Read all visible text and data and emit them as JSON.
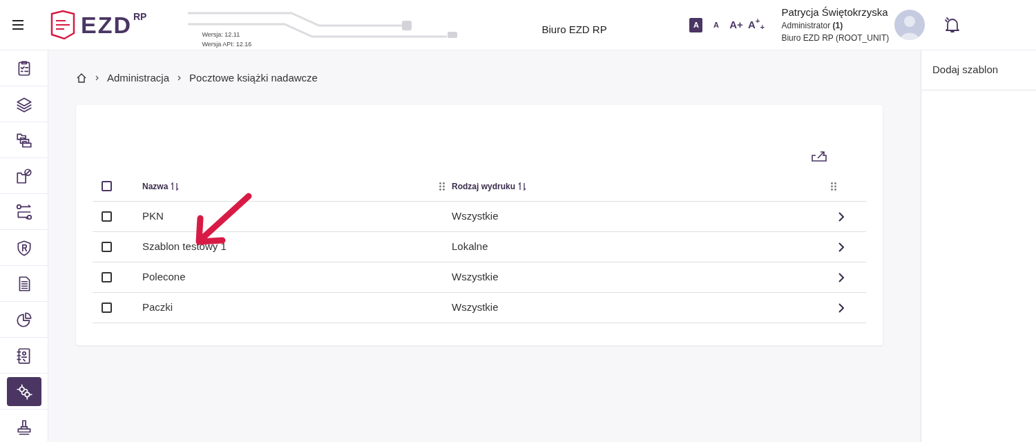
{
  "header": {
    "logo_text": "EZD",
    "logo_sup": "RP",
    "version": "Wersja: 12.11",
    "api_version": "Wersja API: 12.16",
    "unit_title": "Biuro EZD RP",
    "font_sizes": [
      {
        "label": "A",
        "selected": true
      },
      {
        "label": "A",
        "selected": false
      },
      {
        "label": "A+",
        "selected": false
      },
      {
        "label": "A$^{+}$$_{+}$",
        "selected": false
      }
    ],
    "user": {
      "name": "Patrycja Świętokrzyska",
      "role": "Administrator **(1)**",
      "unit": "Biuro EZD RP (ROOT_UNIT)"
    }
  },
  "sidebar": {
    "items": [
      {
        "kind": "clipboard",
        "selected": false
      },
      {
        "kind": "layers",
        "selected": false
      },
      {
        "kind": "folders",
        "selected": false
      },
      {
        "kind": "folder-block",
        "selected": false
      },
      {
        "kind": "flow",
        "selected": false
      },
      {
        "kind": "shield",
        "selected": false
      },
      {
        "kind": "document",
        "selected": false
      },
      {
        "kind": "pie",
        "selected": false
      },
      {
        "kind": "contacts",
        "selected": false
      },
      {
        "kind": "gears",
        "selected": true
      },
      {
        "kind": "stamp",
        "selected": false
      }
    ]
  },
  "breadcrumb": [
    "Administracja",
    "Pocztowe książki nadawcze"
  ],
  "table": {
    "columns": [
      "Nazwa",
      "Rodzaj wydruku"
    ],
    "all_checked": false,
    "rows": [
      {
        "name": "PKN",
        "type": "Wszystkie",
        "checked": false
      },
      {
        "name": "Szablon testowy 1",
        "type": "Lokalne",
        "checked": false
      },
      {
        "name": "Polecone",
        "type": "Wszystkie",
        "checked": false
      },
      {
        "name": "Paczki",
        "type": "Wszystkie",
        "checked": false
      }
    ]
  },
  "right_panel": {
    "button": "Dodaj szablon"
  }
}
